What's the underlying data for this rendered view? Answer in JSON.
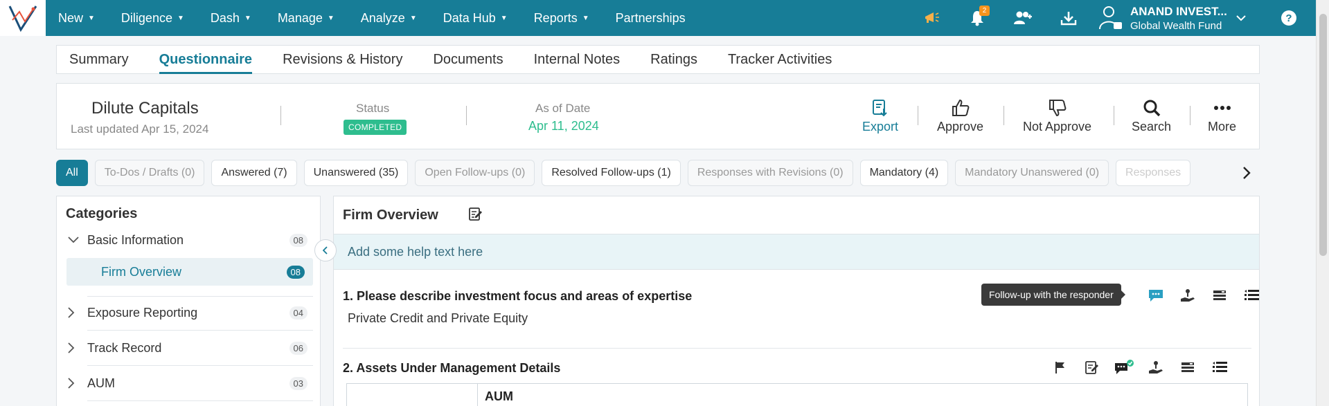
{
  "nav": {
    "items": [
      {
        "label": "New",
        "dropdown": true
      },
      {
        "label": "Diligence",
        "dropdown": true
      },
      {
        "label": "Dash",
        "dropdown": true
      },
      {
        "label": "Manage",
        "dropdown": true
      },
      {
        "label": "Analyze",
        "dropdown": true
      },
      {
        "label": "Data Hub",
        "dropdown": true
      },
      {
        "label": "Reports",
        "dropdown": true
      },
      {
        "label": "Partnerships",
        "dropdown": false
      }
    ],
    "notification_count": "2",
    "user_name": "ANAND INVEST...",
    "user_fund": "Global Wealth Fund",
    "help": "?"
  },
  "tabs": [
    "Summary",
    "Questionnaire",
    "Revisions & History",
    "Documents",
    "Internal Notes",
    "Ratings",
    "Tracker Activities"
  ],
  "active_tab": "Questionnaire",
  "header": {
    "firm_name": "Dilute Capitals",
    "last_updated": "Last updated Apr 15, 2024",
    "status_label": "Status",
    "status_value": "COMPLETED",
    "asof_label": "As of Date",
    "asof_date": "Apr 11, 2024",
    "actions": {
      "export": "Export",
      "approve": "Approve",
      "not_approve": "Not Approve",
      "search": "Search",
      "more": "More"
    }
  },
  "filters": [
    {
      "label": "All",
      "state": "active"
    },
    {
      "label": "To-Dos / Drafts (0)",
      "state": "muted"
    },
    {
      "label": "Answered (7)",
      "state": "normal"
    },
    {
      "label": "Unanswered (35)",
      "state": "normal"
    },
    {
      "label": "Open Follow-ups (0)",
      "state": "muted"
    },
    {
      "label": "Resolved Follow-ups (1)",
      "state": "normal"
    },
    {
      "label": "Responses with Revisions (0)",
      "state": "muted"
    },
    {
      "label": "Mandatory (4)",
      "state": "normal"
    },
    {
      "label": "Mandatory Unanswered (0)",
      "state": "muted"
    },
    {
      "label": "Responses",
      "state": "fade"
    }
  ],
  "categories": {
    "title": "Categories",
    "items": [
      {
        "label": "Basic Information",
        "count": "08",
        "expanded": true
      },
      {
        "label": "Firm Overview",
        "count": "08",
        "sub": true
      },
      {
        "label": "Exposure Reporting",
        "count": "04"
      },
      {
        "label": "Track Record",
        "count": "06"
      },
      {
        "label": "AUM",
        "count": "03"
      }
    ]
  },
  "section": {
    "title": "Firm Overview",
    "help_text": "Add some help text here",
    "questions": [
      {
        "title": "1.  Please describe investment focus and areas of expertise",
        "answer": "Private Credit and Private Equity"
      },
      {
        "title": "2.  Assets Under Management Details",
        "table_header": "AUM"
      }
    ],
    "tooltip": "Follow-up with the responder"
  },
  "colors": {
    "brand": "#177d97",
    "success": "#2ebd8e",
    "badge": "#f7941d"
  }
}
